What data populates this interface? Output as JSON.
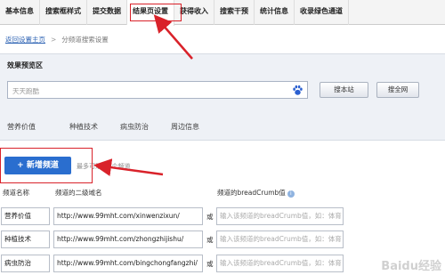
{
  "tabs": [
    {
      "label": "基本信息"
    },
    {
      "label": "搜索框样式"
    },
    {
      "label": "提交数据"
    },
    {
      "label": "结果页设置",
      "active": true
    },
    {
      "label": "获得收入"
    },
    {
      "label": "搜索干预"
    },
    {
      "label": "统计信息"
    },
    {
      "label": "收录绿色通道"
    }
  ],
  "breadcrumb": {
    "home": "返回设置主页",
    "separator": ">",
    "current": "分频道搜索设置"
  },
  "preview": {
    "title": "效果预览区",
    "search_value": "天天跑酷",
    "button_site": "搜本站",
    "button_web": "搜全网",
    "categories": [
      "营养价值",
      "种植技术",
      "病虫防治",
      "周边信息"
    ]
  },
  "add_channel": {
    "label": "新增频道",
    "hint": "最多可添加5个频道"
  },
  "table": {
    "headers": {
      "name": "频道名称",
      "domain": "频道的二级域名",
      "breadcrumb": "频道的breadCrumb值"
    },
    "or_text": "或",
    "breadcrumb_placeholder": "输入该频道的breadCrumb值，如：体育",
    "rows": [
      {
        "name": "营养价值",
        "url": "http://www.99mht.com/xinwenzixun/"
      },
      {
        "name": "种植技术",
        "url": "http://www.99mht.com/zhongzhijishu/"
      },
      {
        "name": "病虫防治",
        "url": "http://www.99mht.com/bingchongfangzhi/"
      }
    ]
  },
  "watermark": "Baidu经验",
  "colors": {
    "accent": "#2a6ecf",
    "annotation": "#d9222a"
  }
}
